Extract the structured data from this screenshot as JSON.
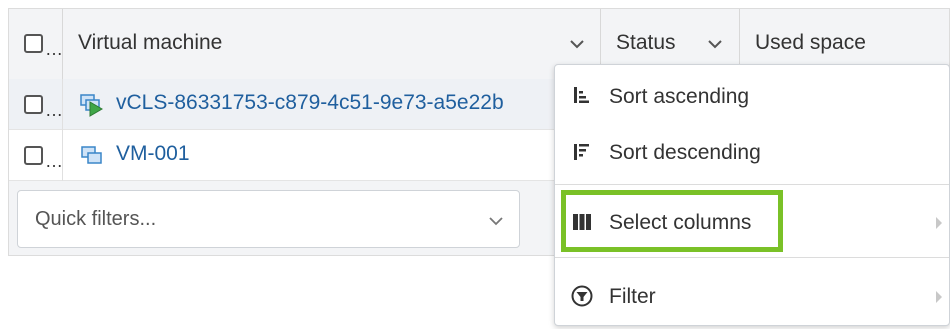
{
  "table": {
    "columns": [
      {
        "label": "Virtual machine"
      },
      {
        "label": "Status"
      },
      {
        "label": "Used space"
      }
    ],
    "rows": [
      {
        "name": "vCLS-86331753-c879-4c51-9e73-a5e22b",
        "icon": "vm-running-icon"
      },
      {
        "name": "VM-001",
        "icon": "vm-icon"
      }
    ],
    "ellipsis": "…"
  },
  "quick_filters": {
    "placeholder": "Quick filters..."
  },
  "context_menu": {
    "items": [
      {
        "label": "Sort ascending",
        "icon": "sort-ascending-icon"
      },
      {
        "label": "Sort descending",
        "icon": "sort-descending-icon"
      },
      {
        "label": "Select columns",
        "icon": "columns-icon",
        "submenu": true
      },
      {
        "label": "Filter",
        "icon": "filter-icon",
        "submenu": true
      }
    ]
  },
  "colors": {
    "accent_highlight": "#7ac127",
    "link": "#1f5f9e",
    "header_bg": "#f3f4f6"
  }
}
